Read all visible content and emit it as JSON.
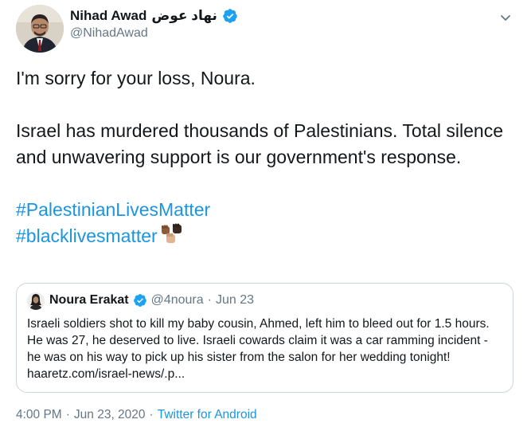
{
  "author": {
    "name": "Nihad Awad",
    "arabic_name": "نهاد عوض",
    "handle": "@NihadAwad",
    "verified_icon": "verified-badge-icon"
  },
  "tweet": {
    "line1": "I'm sorry for your loss, Noura.",
    "paragraph2": "Israel has murdered thousands of Palestinians. Total silence and unwavering support is our government's response.",
    "hashtag1": "#PalestinianLivesMatter",
    "hashtag2": "#blacklivesmatter",
    "emoji": "raised-fists-emoji"
  },
  "quoted_tweet": {
    "name": "Noura Erakat",
    "handle": "@4noura",
    "separator": "·",
    "date": "Jun 23",
    "text": "Israeli soldiers shot to kill my baby cousin, Ahmed, left him to bleed out for 1.5 hours. He was 27, he deserved to live. Israeli cowards claim it was a car ramming incident - he was on his way to pick up his sister from the salon for her wedding tonight! haaretz.com/israel-news/.p..."
  },
  "footer": {
    "time": "4:00 PM",
    "sep1": "·",
    "date": "Jun 23, 2020",
    "sep2": "·",
    "source": "Twitter for Android"
  },
  "colors": {
    "link": "#1b95e0",
    "secondary_text": "#657786",
    "border": "#ccd6dd",
    "verified": "#1da1f2"
  }
}
